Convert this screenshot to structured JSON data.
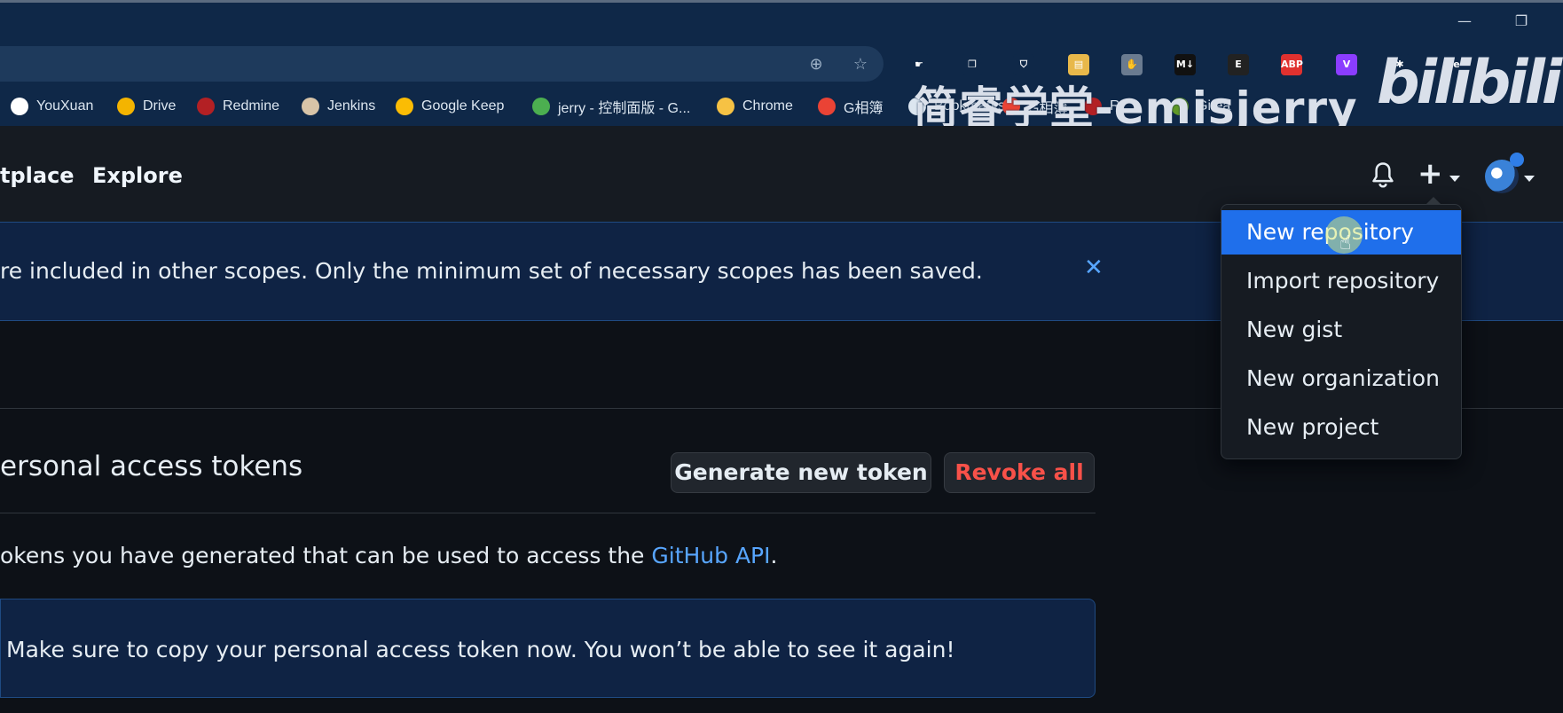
{
  "browser": {
    "window_controls": {
      "minimize": "—",
      "restore": "❐"
    },
    "bookmarks": [
      {
        "label": "YouXuan",
        "icon": "google-icon",
        "color": "#ffffff"
      },
      {
        "label": "Drive",
        "icon": "drive-icon",
        "color": "#f4b400"
      },
      {
        "label": "Redmine",
        "icon": "redmine-icon",
        "color": "#b32024"
      },
      {
        "label": "Jenkins",
        "icon": "jenkins-icon",
        "color": "#d8c4a8"
      },
      {
        "label": "Google Keep",
        "icon": "keep-icon",
        "color": "#fbbc04"
      },
      {
        "label": "jerry - 控制面版 - G...",
        "icon": "gitlab-icon",
        "color": "#4caf50"
      },
      {
        "label": "Chrome",
        "icon": "folder-icon",
        "color": "#f6c244"
      },
      {
        "label": "G相簿",
        "icon": "photos-icon",
        "color": "#ea4335"
      },
      {
        "label": "Bookmarks",
        "icon": "bookmark-file-icon",
        "color": "#dce6f0"
      },
      {
        "label": "G相簿",
        "icon": "photos-icon",
        "color": "#ea4335"
      },
      {
        "label": "R",
        "icon": "redmine-icon",
        "color": "#b32024"
      },
      {
        "label": "Gitea",
        "icon": "gitea-icon",
        "color": "#609926"
      }
    ],
    "extensions": [
      {
        "name": "hand-icon",
        "glyph": "☛",
        "color": "#0f2848"
      },
      {
        "name": "copy-icon",
        "glyph": "❐",
        "color": "#0f2848"
      },
      {
        "name": "shield-icon",
        "glyph": "⛉",
        "color": "#0f2848"
      },
      {
        "name": "note-icon",
        "glyph": "▤",
        "color": "#e8b84a"
      },
      {
        "name": "glove-icon",
        "glyph": "✋",
        "color": "#6a7b90"
      },
      {
        "name": "markdown-icon",
        "glyph": "M↓",
        "color": "#111111"
      },
      {
        "name": "e-icon",
        "glyph": "E",
        "color": "#222222"
      },
      {
        "name": "abp-icon",
        "glyph": "ABP",
        "color": "#e0312f"
      },
      {
        "name": "v-icon",
        "glyph": "V",
        "color": "#8b3dff"
      },
      {
        "name": "puzzle-icon",
        "glyph": "✱",
        "color": "#0f2848"
      },
      {
        "name": "e2-icon",
        "glyph": "e",
        "color": "#0f2848"
      }
    ],
    "watermark": "简睿学堂-emisjerry",
    "bili_logo": "bilibili"
  },
  "header": {
    "nav": [
      "tplace",
      "Explore"
    ],
    "menu": [
      "New repository",
      "Import repository",
      "New gist",
      "New organization",
      "New project"
    ],
    "active_menu_index": 0
  },
  "flash": {
    "text": "re included in other scopes. Only the minimum set of necessary scopes has been saved.",
    "close": "✕"
  },
  "tokens": {
    "title": "ersonal access tokens",
    "generate_label": "Generate new token",
    "revoke_label": "Revoke all",
    "desc_prefix": "okens you have generated that can be used to access the ",
    "desc_link": "GitHub API",
    "desc_suffix": ".",
    "notice": "Make sure to copy your personal access token now. You won’t be able to see it again!"
  }
}
